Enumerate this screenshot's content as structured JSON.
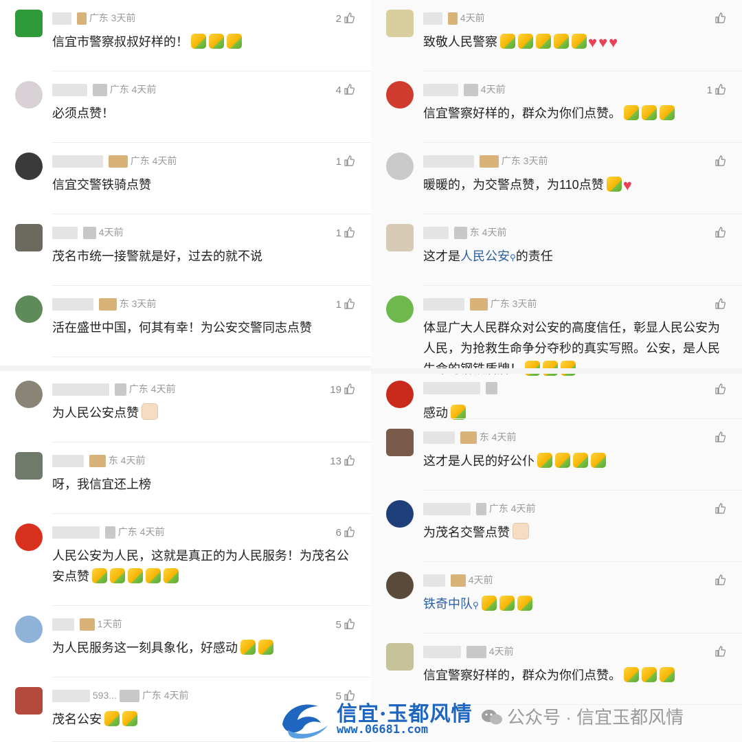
{
  "left": [
    {
      "name": "",
      "region": "广东",
      "time": "3天前",
      "likes": "2",
      "text": "信宜市警察叔叔好样的！",
      "emoji": 3,
      "avatar": "#2f9a3a"
    },
    {
      "name": "",
      "region": "广东",
      "time": "4天前",
      "likes": "4",
      "text": "必须点赞！",
      "emoji": 0,
      "avatar": "#d8d2d6"
    },
    {
      "name": "",
      "region": "广东",
      "time": "4天前",
      "likes": "1",
      "text": "信宜交警铁骑点赞",
      "emoji": 0,
      "avatar": "#3a3a3a"
    },
    {
      "name": "",
      "region": "",
      "time": "4天前",
      "likes": "1",
      "text": "茂名市统一接警就是好，过去的就不说",
      "emoji": 0,
      "avatar": "#6c6a5e"
    },
    {
      "name": "",
      "region": "东",
      "time": "3天前",
      "likes": "1",
      "text": "活在盛世中国，何其有幸！为公安交警同志点赞",
      "emoji": 0,
      "avatar": "#5f8a5a"
    },
    {
      "name": "",
      "region": "广东",
      "time": "4天前",
      "likes": "19",
      "text": "为人民公安点赞",
      "emoji": 1,
      "emojiStyle": "light",
      "avatar": "#8a8476"
    },
    {
      "name": "",
      "region": "东",
      "time": "4天前",
      "likes": "13",
      "text": "呀，我信宜还上榜",
      "emoji": 0,
      "avatar": "#6f7a6a"
    },
    {
      "name": "",
      "region": "广东",
      "time": "4天前",
      "likes": "6",
      "text": "人民公安为人民，这就是真正的为人民服务！为茂名公安点赞",
      "emoji": 5,
      "avatar": "#d8321f"
    },
    {
      "name": "",
      "region": "",
      "time": "1天前",
      "likes": "5",
      "text": "为人民服务这一刻具象化，好感动",
      "emoji": 2,
      "avatar": "#8fb3d8"
    },
    {
      "name": "593...",
      "region": "广东",
      "time": "4天前",
      "likes": "5",
      "text": "茂名公安",
      "emoji": 2,
      "avatar": "#b34a3c"
    }
  ],
  "right": [
    {
      "name": "",
      "region": "",
      "time": "4天前",
      "likes": "",
      "text": "致敬人民警察",
      "emoji": 5,
      "hearts": 3,
      "avatar": "#d9cf9e"
    },
    {
      "name": "",
      "region": "",
      "time": "4天前",
      "likes": "1",
      "text": "信宜警察好样的，群众为你们点赞。",
      "emoji": 3,
      "avatar": "#cf3b2e"
    },
    {
      "name": "",
      "region": "广东",
      "time": "3天前",
      "likes": "",
      "text": "暖暖的，为交警点赞，为110点赞",
      "emoji": 1,
      "hearts": 1,
      "avatar": "#c9c9c9"
    },
    {
      "name": "",
      "region": "东",
      "time": "4天前",
      "likes": "",
      "text": "这才是",
      "link": "人民公安",
      "textAfter": "的责任",
      "emoji": 0,
      "avatar": "#d7cbb5"
    },
    {
      "name": "",
      "region": "广东",
      "time": "3天前",
      "likes": "",
      "text": "体显广大人民群众对公安的高度信任，彰显人民公安为人民，为抢救生命争分夺秒的真实写照。公安，是人民生命的钢铁盾牌！",
      "emoji": 3,
      "avatar": "#6fb84e"
    },
    {
      "name": "",
      "region": "",
      "time": "",
      "likes": "",
      "text": "感动",
      "emoji": 1,
      "avatar": "#c92a1c"
    },
    {
      "name": "",
      "region": "东",
      "time": "4天前",
      "likes": "",
      "text": "这才是人民的好公仆",
      "emoji": 4,
      "avatar": "#7a5a4a"
    },
    {
      "name": "",
      "region": "广东",
      "time": "4天前",
      "likes": "",
      "text": "为茂名交警点赞",
      "emoji": 1,
      "emojiStyle": "light",
      "avatar": "#1f3f7a"
    },
    {
      "name": "",
      "region": "",
      "time": "4天前",
      "likes": "",
      "text": "",
      "link": "铁奇中队",
      "textAfter": "",
      "emoji": 3,
      "avatar": "#5a4a3a"
    },
    {
      "name": "",
      "region": "",
      "time": "4天前",
      "likes": "",
      "text": "信宜警察好样的，群众为你们点赞。",
      "emoji": 3,
      "avatar": "#c6c39a"
    }
  ],
  "watermark": {
    "site_name": "信宜·玉都风情",
    "site_url": "www.06681.com",
    "wechat": "公众号 · 信宜玉都风情"
  }
}
